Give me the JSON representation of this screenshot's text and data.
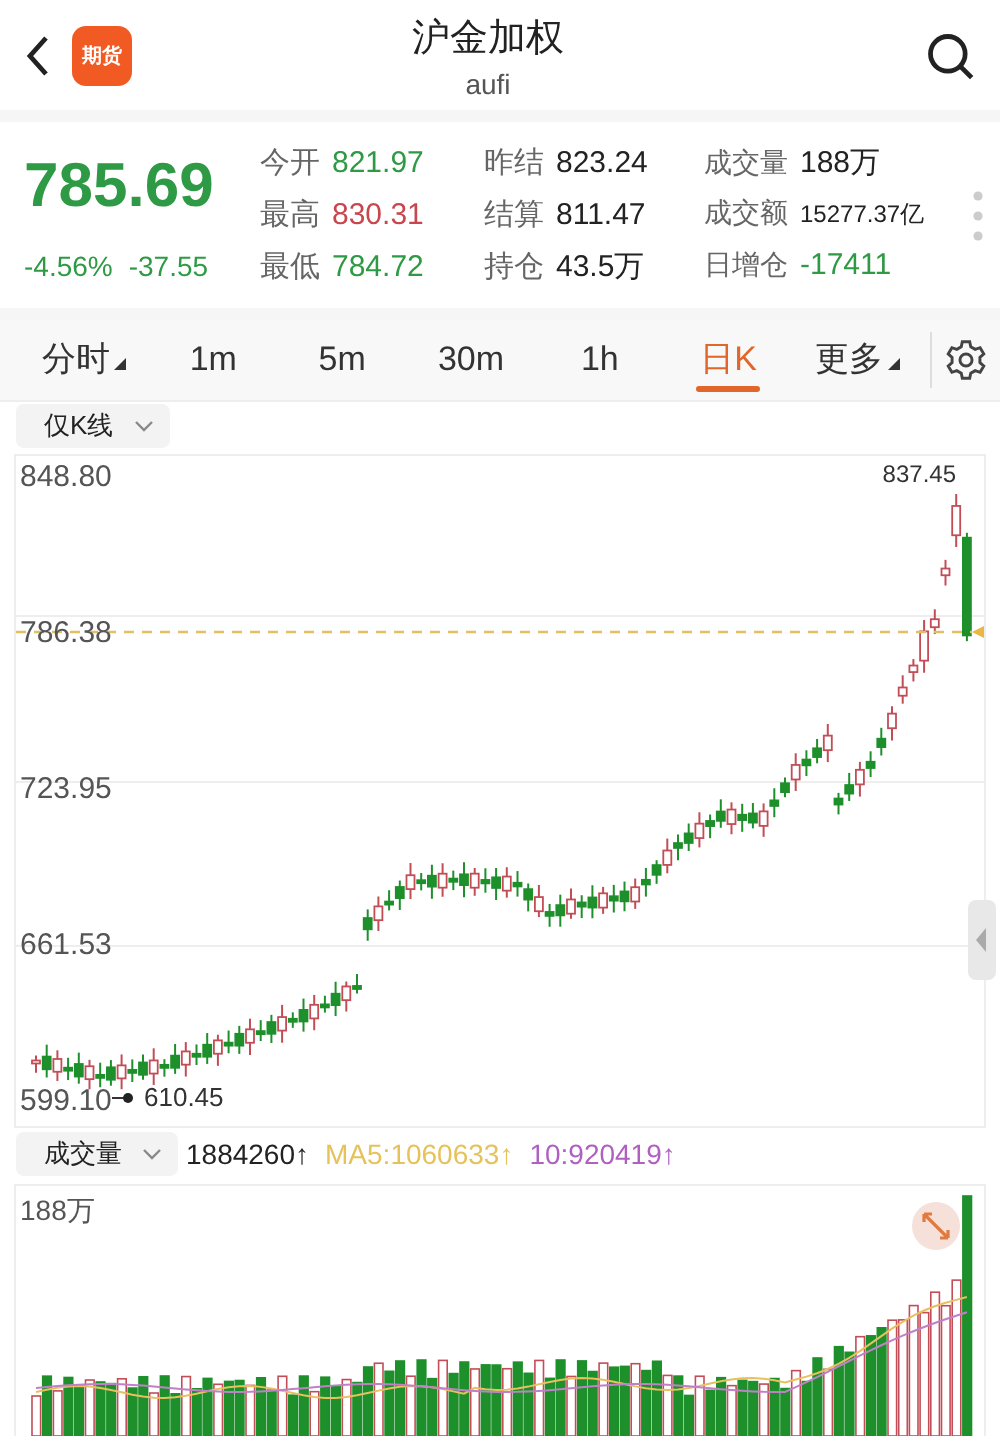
{
  "header": {
    "logo": "期货",
    "title": "沪金加权",
    "subtitle": "aufi"
  },
  "quote": {
    "price": "785.69",
    "change_percent": "-4.56%",
    "change": "-37.55",
    "color": "#2f9a45",
    "fields": [
      {
        "label": "今开",
        "value": "821.97",
        "color": "#2f9a45"
      },
      {
        "label": "昨结",
        "value": "823.24",
        "color": "#222222"
      },
      {
        "label": "成交量",
        "value": "188万",
        "color": "#222222"
      },
      {
        "label": "最高",
        "value": "830.31",
        "color": "#c8474f"
      },
      {
        "label": "结算",
        "value": "811.47",
        "color": "#222222"
      },
      {
        "label": "成交额",
        "value": "15277.37亿",
        "color": "#222222"
      },
      {
        "label": "最低",
        "value": "784.72",
        "color": "#2f9a45"
      },
      {
        "label": "持仓",
        "value": "43.5万",
        "color": "#222222"
      },
      {
        "label": "日增仓",
        "value": "-17411",
        "color": "#2f9a45"
      }
    ]
  },
  "tabs": [
    {
      "label": "分时",
      "selected": false,
      "has_menu": true
    },
    {
      "label": "1m",
      "selected": false,
      "has_menu": false
    },
    {
      "label": "5m",
      "selected": false,
      "has_menu": false
    },
    {
      "label": "30m",
      "selected": false,
      "has_menu": false
    },
    {
      "label": "1h",
      "selected": false,
      "has_menu": false
    },
    {
      "label": "日K",
      "selected": true,
      "has_menu": false
    },
    {
      "label": "更多",
      "selected": false,
      "has_menu": true
    }
  ],
  "chart_mode": "仅K线",
  "price_chart": {
    "axis_labels": [
      "848.80",
      "786.38",
      "723.95",
      "661.53",
      "599.10"
    ],
    "high_label": "837.45",
    "low_label": "610.45"
  },
  "volume": {
    "selector": "成交量",
    "readings": [
      {
        "text": "1884260↑",
        "kind": "volume"
      },
      {
        "text": "MA5:1060633↑",
        "kind": "ma5"
      },
      {
        "text": "10:920419↑",
        "kind": "ma10"
      }
    ],
    "axis_label": "188万"
  }
}
